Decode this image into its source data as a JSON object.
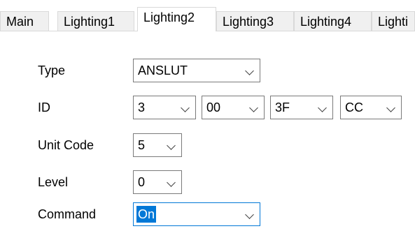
{
  "tabs": [
    {
      "label": "Main"
    },
    {
      "label": "Lighting1"
    },
    {
      "label": "Lighting2"
    },
    {
      "label": "Lighting3"
    },
    {
      "label": "Lighting4"
    },
    {
      "label": "Lighti"
    }
  ],
  "active_tab": "Lighting2",
  "form": {
    "type": {
      "label": "Type",
      "value": "ANSLUT"
    },
    "id": {
      "label": "ID",
      "values": [
        "3",
        "00",
        "3F",
        "CC"
      ]
    },
    "unit_code": {
      "label": "Unit Code",
      "value": "5"
    },
    "level": {
      "label": "Level",
      "value": "0"
    },
    "command": {
      "label": "Command",
      "value": "On"
    }
  },
  "colors": {
    "focus_accent": "#0078d7",
    "tab_border": "#d9d9d9",
    "control_border": "#7a7a7a"
  }
}
